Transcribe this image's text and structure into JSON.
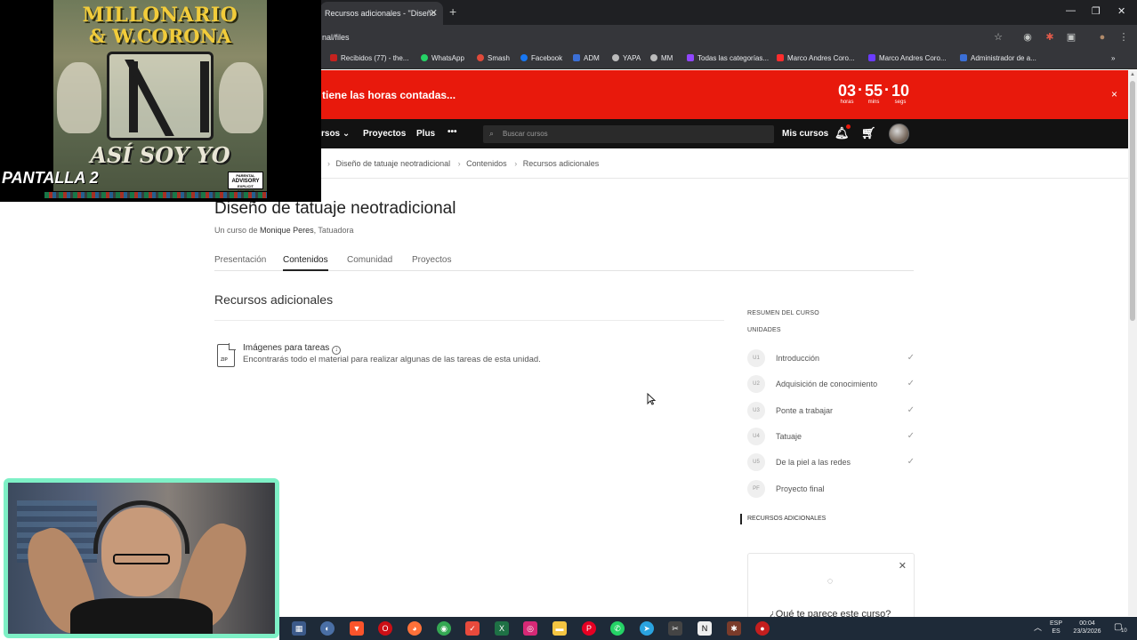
{
  "browser": {
    "tab_title": "Recursos adicionales - \"Diseño",
    "url": "nal/files",
    "bookmarks": [
      {
        "label": "Recibidos (77) - the...",
        "color": "#c5221f"
      },
      {
        "label": "WhatsApp",
        "color": "#25d366"
      },
      {
        "label": "Smash",
        "color": "#e04a3a"
      },
      {
        "label": "Facebook",
        "color": "#1877f2"
      },
      {
        "label": "ADM",
        "color": "#3b6fd6"
      },
      {
        "label": "YAPA",
        "color": "#bbbbbb"
      },
      {
        "label": "MM",
        "color": "#bbbbbb"
      },
      {
        "label": "Todas las categorías...",
        "color": "#9146ff"
      },
      {
        "label": "Marco Andres Coro...",
        "color": "#ff2d2d"
      },
      {
        "label": "Marco Andres Coro...",
        "color": "#6b3bff"
      },
      {
        "label": "Administrador de a...",
        "color": "#3b6fd6"
      }
    ]
  },
  "promo": {
    "text": "tiene las horas contadas...",
    "hours": "03",
    "hours_label": "horas",
    "mins": "55",
    "mins_label": "mins",
    "secs": "10",
    "secs_label": "segs",
    "close": "×"
  },
  "nav": {
    "courses": "rsos",
    "projects": "Proyectos",
    "plus": "Plus",
    "more": "•••",
    "search_placeholder": "Buscar cursos",
    "my_courses": "Mis cursos"
  },
  "breadcrumb": [
    "Diseño de tatuaje neotradicional",
    "Contenidos",
    "Recursos adicionales"
  ],
  "course": {
    "title": "Diseño de tatuaje neotradicional",
    "by": "Un curso de",
    "author": "Monique Peres",
    "role": ", Tatuadora",
    "tabs": [
      "Presentación",
      "Contenidos",
      "Comunidad",
      "Proyectos"
    ]
  },
  "section": {
    "title": "Recursos adicionales",
    "resource": {
      "title": "Imágenes para tareas",
      "description": "Encontrarás todo el material para realizar algunas de las tareas de esta unidad.",
      "file_type": "ZIP"
    }
  },
  "sidebar": {
    "summary_heading": "RESUMEN DEL CURSO",
    "units_heading": "UNIDADES",
    "units": [
      {
        "badge": "U1",
        "label": "Introducción",
        "done": "✓"
      },
      {
        "badge": "U2",
        "label": "Adquisición de conocimiento",
        "done": "✓"
      },
      {
        "badge": "U3",
        "label": "Ponte a trabajar",
        "done": "✓"
      },
      {
        "badge": "U4",
        "label": "Tatuaje",
        "done": "✓"
      },
      {
        "badge": "U5",
        "label": "De la piel a las redes",
        "done": "✓"
      },
      {
        "badge": "PF",
        "label": "Proyecto final",
        "done": ""
      }
    ],
    "resources_heading": "RECURSOS ADICIONALES",
    "feedback_question": "¿Qué te parece este curso?"
  },
  "overlay": {
    "album_line1": "MILLONARIO",
    "album_line2": "& W.CORONA",
    "album_line3": "ASÍ SOY YO",
    "advisory_top": "PARENTAL",
    "advisory_mid": "ADVISORY",
    "advisory_bottom": "EXPLICIT CONTENT",
    "scene_label": "PANTALLA 2"
  },
  "taskbar": {
    "lang_top": "ESP",
    "lang_bottom": "ES",
    "time": "00:04",
    "date": "23/3/2026",
    "notifications": "10"
  }
}
